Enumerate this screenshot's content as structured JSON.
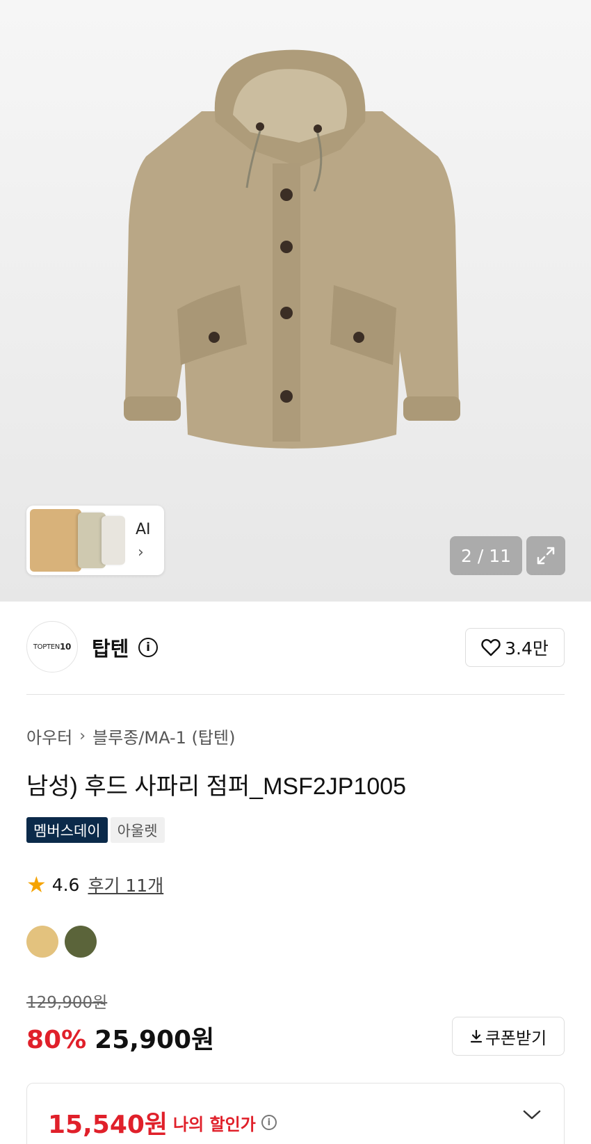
{
  "gallery": {
    "counter": "2 / 11",
    "ai_label": "AI",
    "chevron_glyph": "›"
  },
  "brand": {
    "logo_text_light": "TOPTEN",
    "logo_text_bold": "10",
    "name": "탑텐",
    "like_count": "3.4만"
  },
  "product": {
    "breadcrumb": [
      "아우터",
      "블루종/MA-1 (탑텐)"
    ],
    "title": "남성) 후드 사파리 점퍼_MSF2JP1005",
    "badges": [
      "멤버스데이",
      "아울렛"
    ],
    "rating": "4.6",
    "reviews": "후기 11개",
    "swatch_colors": [
      "#e3c27e",
      "#5b643a"
    ],
    "original_price": "129,900원",
    "discount": "80%",
    "price": "25,900원",
    "coupon_label": "쿠폰받기",
    "my_price": "15,540원",
    "my_price_label": "나의 할인가"
  },
  "colors": {
    "accent_red": "#e0202a",
    "member_badge": "#0b2a4a",
    "star": "#f5a300"
  }
}
